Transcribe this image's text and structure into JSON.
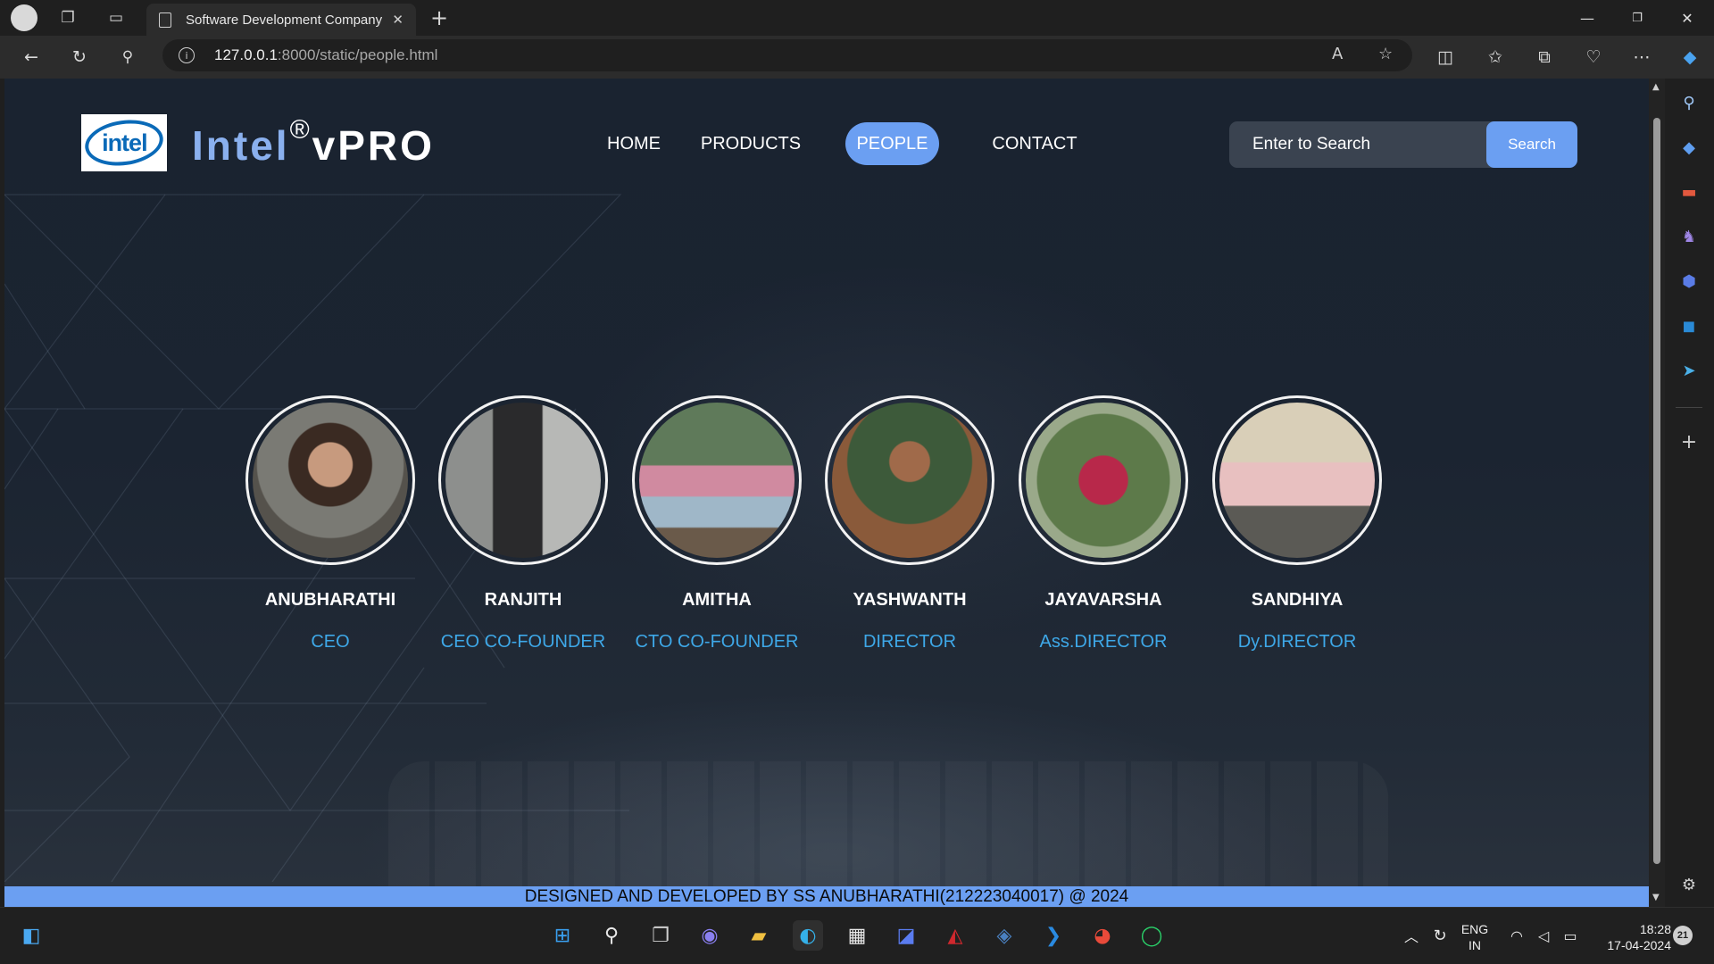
{
  "browser": {
    "tab_title": "Software Development Company",
    "url_host": "127.0.0.1",
    "url_path": ":8000/static/people.html"
  },
  "site": {
    "logo_text": "intel",
    "brand_main": "Intel",
    "brand_reg": "®",
    "brand_suffix": "vPRO",
    "nav": [
      {
        "label": "HOME",
        "active": false
      },
      {
        "label": "PRODUCTS",
        "active": false
      },
      {
        "label": "PEOPLE",
        "active": true
      },
      {
        "label": "CONTACT",
        "active": false
      }
    ],
    "search": {
      "placeholder": "Enter to Search",
      "button_label": "Search"
    },
    "people": [
      {
        "name": "ANUBHARATHI",
        "role": "CEO"
      },
      {
        "name": "RANJITH",
        "role": "CEO CO-FOUNDER"
      },
      {
        "name": "AMITHA",
        "role": "CTO CO-FOUNDER"
      },
      {
        "name": "YASHWANTH",
        "role": "DIRECTOR"
      },
      {
        "name": "JAYAVARSHA",
        "role": "Ass.DIRECTOR"
      },
      {
        "name": "SANDHIYA",
        "role": "Dy.DIRECTOR"
      }
    ],
    "footer": "DESIGNED AND DEVELOPED BY SS ANUBHARATHI(212223040017) @ 2024"
  },
  "colors": {
    "accent": "#6b9ff2",
    "role_text": "#3ea8e8",
    "brand_blue": "#8ab0ee"
  },
  "taskbar": {
    "lang_line1": "ENG",
    "lang_line2": "IN",
    "time": "18:28",
    "date": "17-04-2024",
    "notification_count": "21"
  }
}
